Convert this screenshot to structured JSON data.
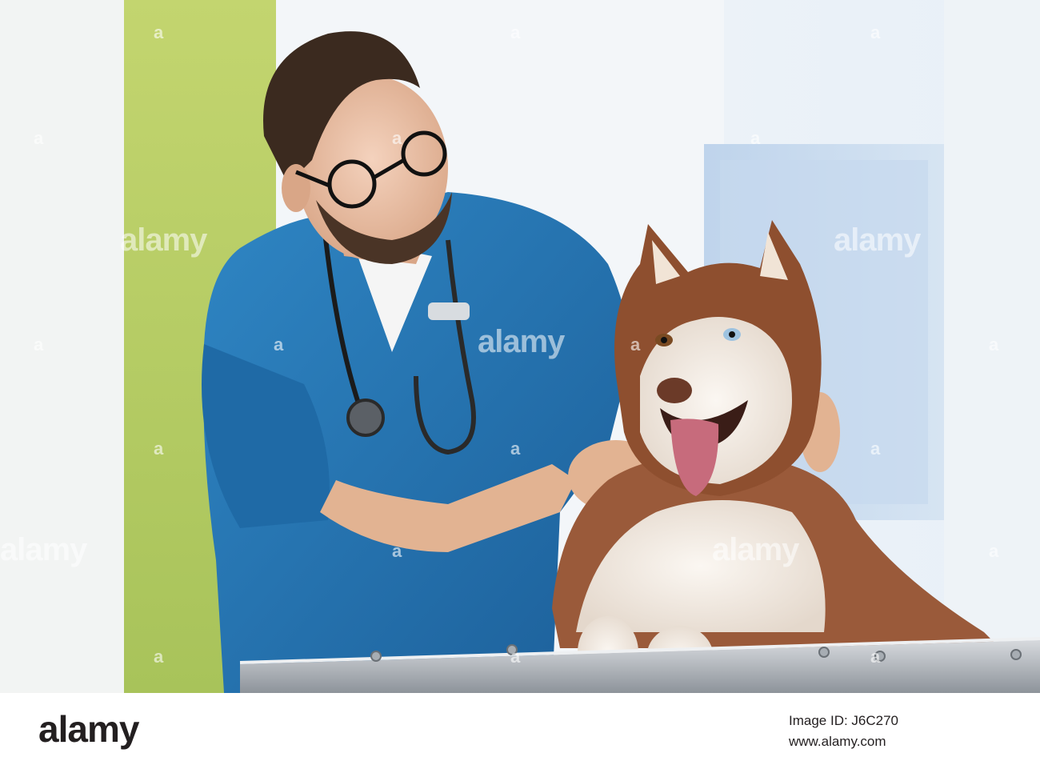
{
  "photo": {
    "description_alt": "",
    "watermark_text": "alamy",
    "watermark_glyph": "a"
  },
  "footer": {
    "logo": "alamy",
    "image_id_line": "Image ID: J6C270",
    "site_line": "www.alamy.com"
  }
}
